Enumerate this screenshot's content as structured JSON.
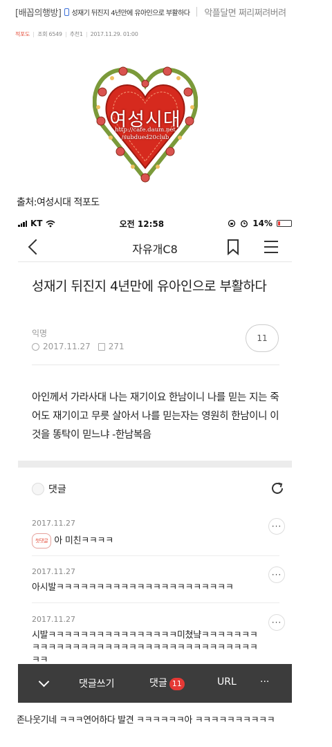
{
  "post": {
    "board_tag": "[배꼽의행방]",
    "title": "성재기 뒤진지 4년만에 유아인으로 부활하다",
    "nickname": "악플달면 쩌리쩌려버려",
    "category": "적포도",
    "views_text": "조회 6549",
    "recommend_text": "추천1",
    "datetime": "2017.11.29. 01:00"
  },
  "logo": {
    "name": "여성시대",
    "url_line1": "http://cafe.daum.net",
    "url_line2": "/subdued20club"
  },
  "source_text": "출처:여성시대 적포도",
  "phone": {
    "carrier": "KT",
    "time": "오전 12:58",
    "battery": "14%",
    "app_title": "자유개C8",
    "article": {
      "title": "성재기 뒤진지 4년만에 유아인으로 부활하다",
      "author": "익명",
      "date": "2017.11.27",
      "views": "271",
      "comment_count": "11",
      "body": "아인께서 가라사대 나는 재기이요 한남이니 나를 믿는 지는 죽어도 재기이고 무릇 살아서 나를 믿는자는 영원히 한남이니 이것을 똥탁이 믿느냐 -한남복음"
    },
    "comments_label": "댓글",
    "comments": [
      {
        "date": "2017.11.27",
        "badge": "첫댓글",
        "text": "아 미친ㅋㅋㅋㅋ"
      },
      {
        "date": "2017.11.27",
        "text": "아시발ㅋㅋㅋㅋㅋㅋㅋㅋㅋㅋㅋㅋㅋㅋㅋㅋㅋㅋㅋㅋㅋㅋ"
      },
      {
        "date": "2017.11.27",
        "text": "시발ㅋㅋㅋㅋㅋㅋㅋㅋㅋㅋㅋㅋㅋㅋㅋㅋ미쳤냨ㅋㅋㅋㅋㅋㅋㅋㅋㅋㅋㅋㅋㅋㅋㅋㅋㅋㅋㅋㅋㅋㅋㅋㅋㅋㅋㅋㅋㅋㅋㅋㅋㅋㅋㅋㅋㅋ"
      }
    ],
    "toolbar": {
      "write_label": "댓글쓰기",
      "comment_label": "댓글",
      "comment_count": "11",
      "url_label": "URL",
      "more_label": "···"
    }
  },
  "footer_text": "존나웃기네 ㅋㅋㅋ연어하다 발견 ㅋㅋㅋㅋㅋㅋ아 ㅋㅋㅋㅋㅋㅋㅋㅋㅋㅋ",
  "colors": {
    "accent_red": "#e5523f",
    "badge_red": "#e53935",
    "toolbar_bg": "#3c3c3c",
    "heart_red": "#d62a1e"
  }
}
